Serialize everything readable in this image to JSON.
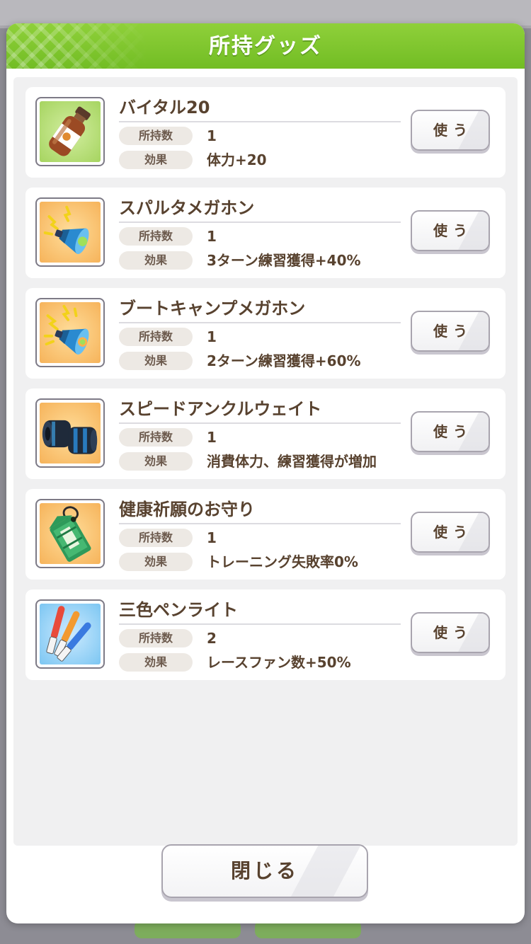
{
  "dialog": {
    "title": "所持グッズ",
    "close_label": "閉じる"
  },
  "labels": {
    "count": "所持数",
    "effect": "効果",
    "use": "使う"
  },
  "items": [
    {
      "name": "バイタル20",
      "count": "1",
      "effect": "体力+20",
      "icon": "drink-bottle-icon",
      "icon_bg": "#a6d460"
    },
    {
      "name": "スパルタメガホン",
      "count": "1",
      "effect": "3ターン練習獲得+40%",
      "icon": "megaphone-icon",
      "icon_bg": "#f6b35a"
    },
    {
      "name": "ブートキャンプメガホン",
      "count": "1",
      "effect": "2ターン練習獲得+60%",
      "icon": "megaphone-icon",
      "icon_bg": "#f6b35a"
    },
    {
      "name": "スピードアンクルウェイト",
      "count": "1",
      "effect": "消費体力、練習獲得が増加",
      "icon": "ankle-weight-icon",
      "icon_bg": "#f6b35a"
    },
    {
      "name": "健康祈願のお守り",
      "count": "1",
      "effect": "トレーニング失敗率0%",
      "icon": "amulet-icon",
      "icon_bg": "#f6b35a"
    },
    {
      "name": "三色ペンライト",
      "count": "2",
      "effect": "レースファン数+50%",
      "icon": "penlight-icon",
      "icon_bg": "#7cc6f2"
    }
  ],
  "colors": {
    "header_green": "#7cc52c",
    "text_brown": "#58422f",
    "list_bg": "#f0f0f1"
  }
}
